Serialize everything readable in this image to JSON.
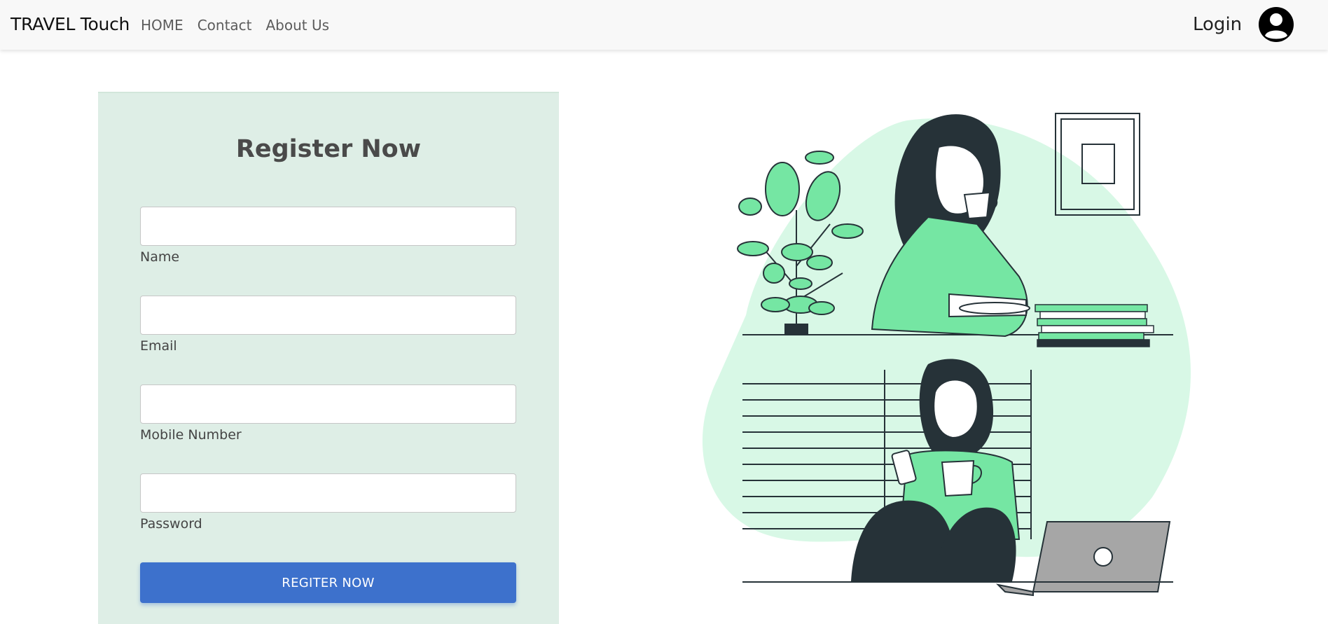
{
  "navbar": {
    "brand": "TRAVEL Touch",
    "links": [
      "HOME",
      "Contact",
      "About Us"
    ],
    "login": "Login",
    "avatar_icon": "user-circle-icon"
  },
  "form": {
    "title": "Register Now",
    "fields": [
      {
        "label": "Name",
        "value": ""
      },
      {
        "label": "Email",
        "value": ""
      },
      {
        "label": "Mobile Number",
        "value": ""
      },
      {
        "label": "Password",
        "value": ""
      }
    ],
    "submit_label": "REGITER NOW"
  },
  "illustration": {
    "subject": "two women drinking coffee illustration",
    "colors": {
      "accent": "#75e6a3",
      "blob": "#d8f8e6",
      "dark": "#263238"
    }
  }
}
